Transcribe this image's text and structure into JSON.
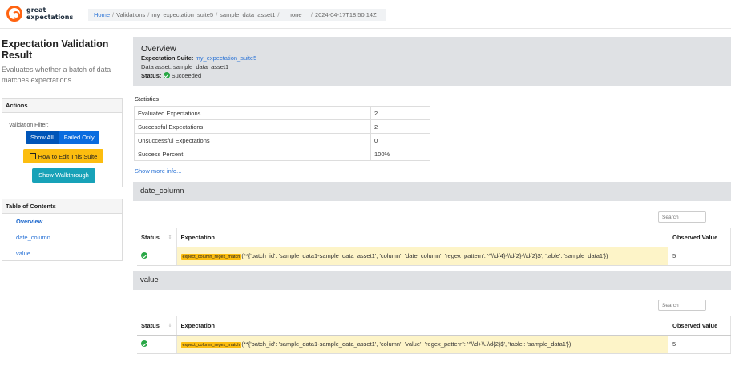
{
  "brand": {
    "line1": "great",
    "line2": "expectations"
  },
  "breadcrumb": {
    "home": "Home",
    "validations": "Validations",
    "suite": "my_expectation_suite5",
    "asset": "sample_data_asset1",
    "none": "__none__",
    "run": "2024-04-17T18:50:14Z"
  },
  "sidebar": {
    "title": "Expectation Validation Result",
    "subtitle": "Evaluates whether a batch of data matches expectations.",
    "actions": {
      "header": "Actions",
      "filter_label": "Validation Filter:",
      "show_all": "Show All",
      "failed_only": "Failed Only",
      "edit": "How to Edit This Suite",
      "walkthrough": "Show Walkthrough"
    },
    "toc": {
      "header": "Table of Contents",
      "items": [
        "Overview",
        "date_column",
        "value"
      ]
    }
  },
  "overview": {
    "title": "Overview",
    "suite_label": "Expectation Suite:",
    "suite_value": "my_expectation_suite5",
    "asset_line": "Data asset: sample_data_asset1",
    "status_label": "Status:",
    "status_value": "Succeeded"
  },
  "statistics": {
    "title": "Statistics",
    "rows": [
      {
        "label": "Evaluated Expectations",
        "value": "2"
      },
      {
        "label": "Successful Expectations",
        "value": "2"
      },
      {
        "label": "Unsuccessful Expectations",
        "value": "0"
      },
      {
        "label": "Success Percent",
        "value": "100%"
      }
    ],
    "more": "Show more info..."
  },
  "sections": [
    {
      "name": "date_column",
      "search_placeholder": "Search",
      "headers": [
        "Status",
        "Expectation",
        "Observed Value"
      ],
      "row": {
        "tag": "expect_column_regex_match",
        "text": "(**{'batch_id': 'sample_data1-sample_data_asset1', 'column': 'date_column', 'regex_pattern': '^\\\\d{4}-\\\\d{2}-\\\\d{2}$', 'table': 'sample_data1'})",
        "observed": "5"
      }
    },
    {
      "name": "value",
      "search_placeholder": "Search",
      "headers": [
        "Status",
        "Expectation",
        "Observed Value"
      ],
      "row": {
        "tag": "expect_column_regex_match",
        "text": "(**{'batch_id': 'sample_data1-sample_data_asset1', 'column': 'value', 'regex_pattern': '^\\\\d+\\\\.\\\\d{2}$', 'table': 'sample_data1'})",
        "observed": "5"
      }
    }
  ],
  "colors": {
    "accent": "#0a6cdf",
    "warning": "#fcbd0f",
    "info": "#17a2b8",
    "success": "#28a745",
    "brand": "#ff6310"
  }
}
